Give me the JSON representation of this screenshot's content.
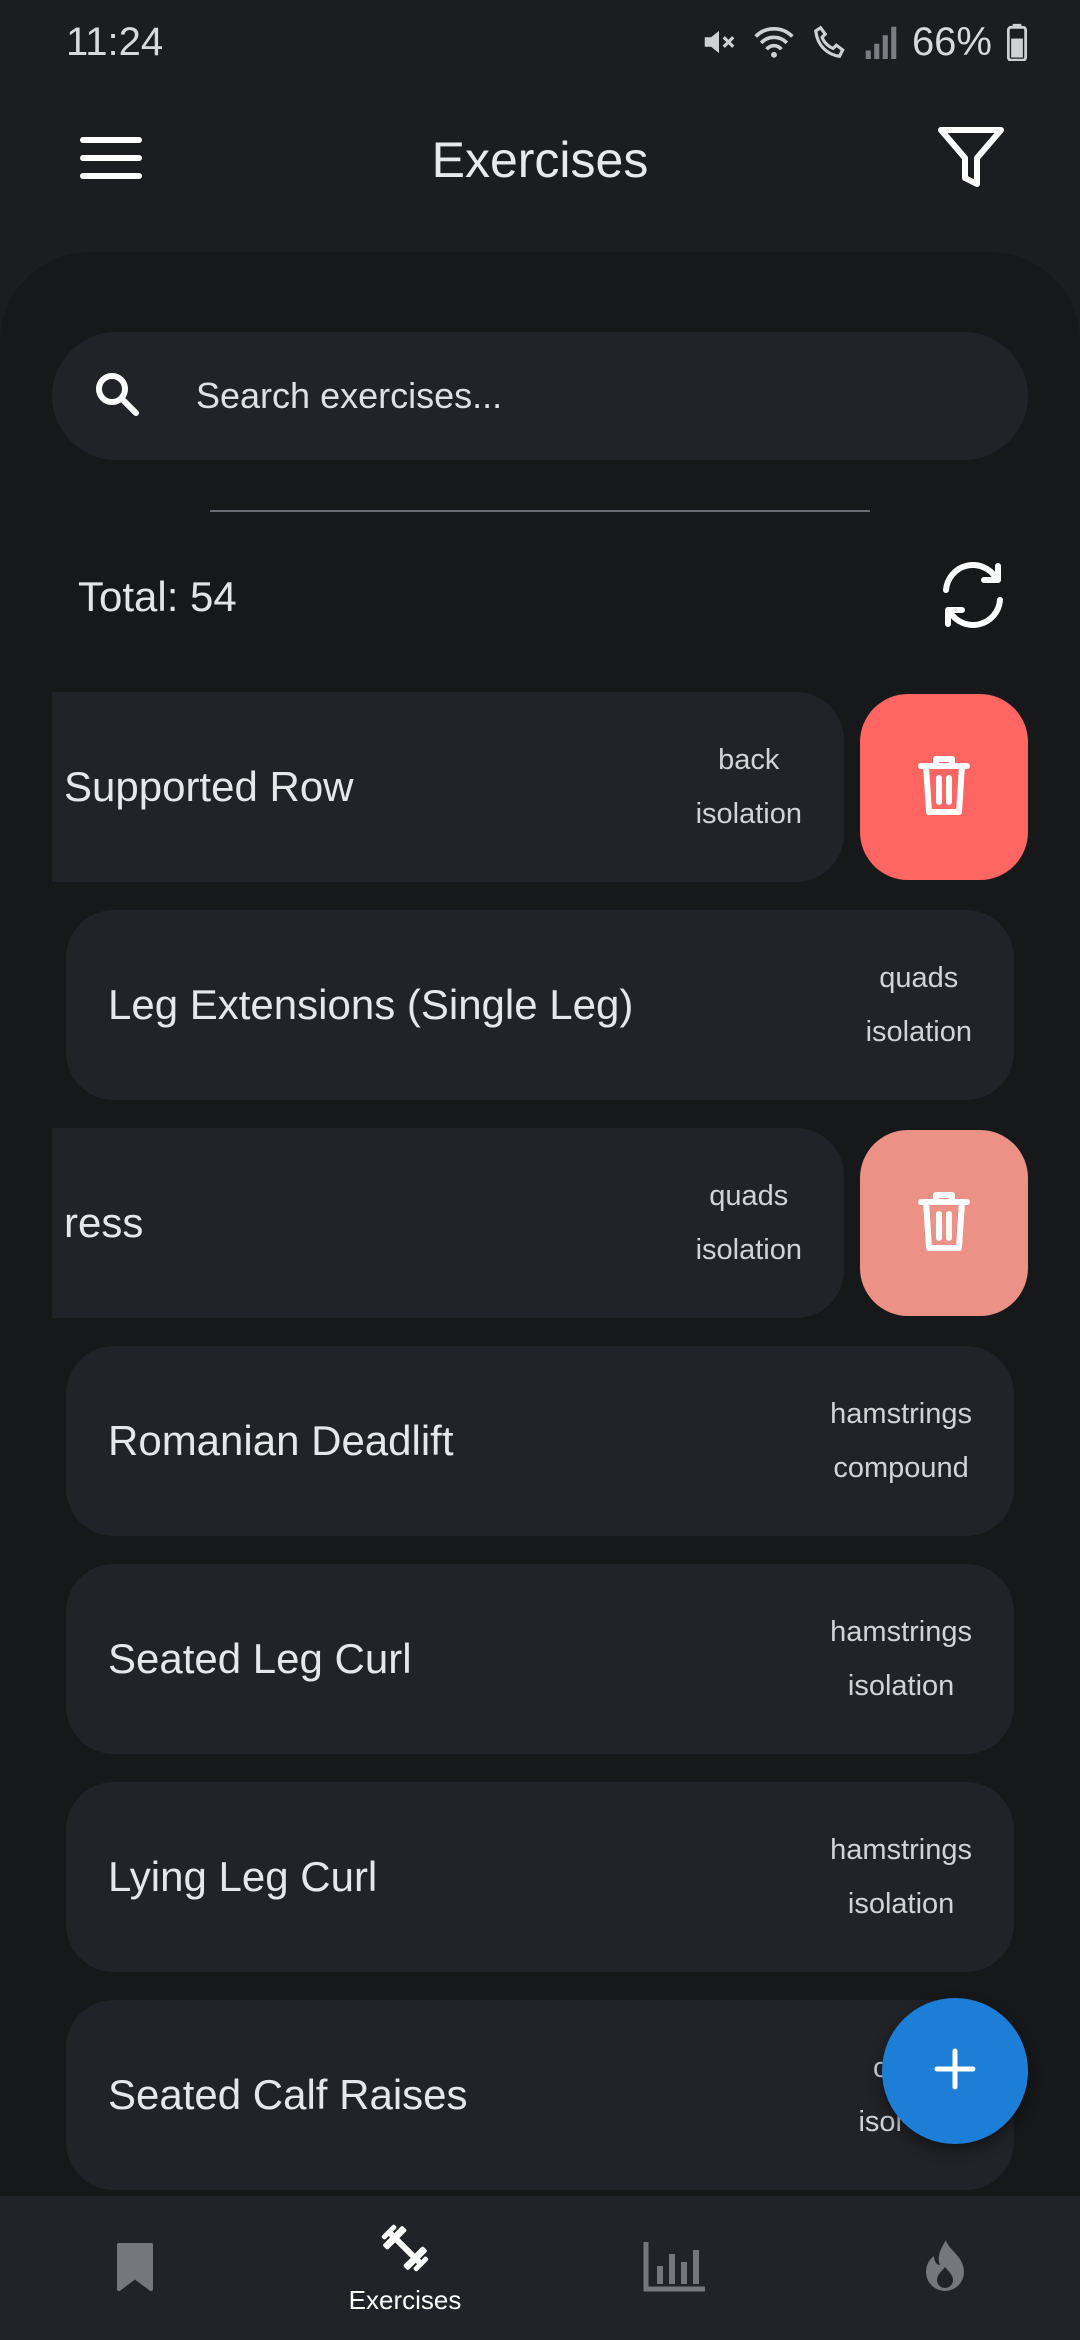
{
  "status_bar": {
    "time": "11:24",
    "battery": "66%",
    "icons": [
      "mute-icon",
      "wifi-icon",
      "call-icon",
      "signal-icon",
      "battery-icon"
    ]
  },
  "top_bar": {
    "title": "Exercises",
    "menu_icon": "hamburger-menu-icon",
    "filter_icon": "filter-icon"
  },
  "search": {
    "placeholder": "Search exercises..."
  },
  "summary": {
    "total": "Total: 54",
    "refresh_icon": "refresh-icon"
  },
  "exercises": [
    {
      "name": "Supported Row",
      "muscle": "back",
      "type": "isolation",
      "swiped": true,
      "delete_color": "#fe6563"
    },
    {
      "name": "Leg Extensions (Single Leg)",
      "muscle": "quads",
      "type": "isolation",
      "swiped": false
    },
    {
      "name": "ress",
      "muscle": "quads",
      "type": "isolation",
      "swiped": true,
      "delete_color": "#ec9186"
    },
    {
      "name": "Romanian Deadlift",
      "muscle": "hamstrings",
      "type": "compound",
      "swiped": false
    },
    {
      "name": "Seated Leg Curl",
      "muscle": "hamstrings",
      "type": "isolation",
      "swiped": false
    },
    {
      "name": "Lying Leg Curl",
      "muscle": "hamstrings",
      "type": "isolation",
      "swiped": false
    },
    {
      "name": "Seated Calf Raises",
      "muscle": "c",
      "type": "isol",
      "swiped": false
    }
  ],
  "fab": {
    "icon": "plus-icon",
    "color": "#1c7ed6"
  },
  "bottom_nav": {
    "items": [
      {
        "icon": "bookmark-icon",
        "label": ""
      },
      {
        "icon": "barbell-icon",
        "label": "Exercises",
        "active": true
      },
      {
        "icon": "bar-chart-icon",
        "label": ""
      },
      {
        "icon": "flame-icon",
        "label": ""
      }
    ]
  },
  "colors": {
    "background": "#1c1d21",
    "sheet": "#17181a",
    "card": "#212328",
    "accent": "#1c7ed6",
    "delete": "#fe6563"
  }
}
